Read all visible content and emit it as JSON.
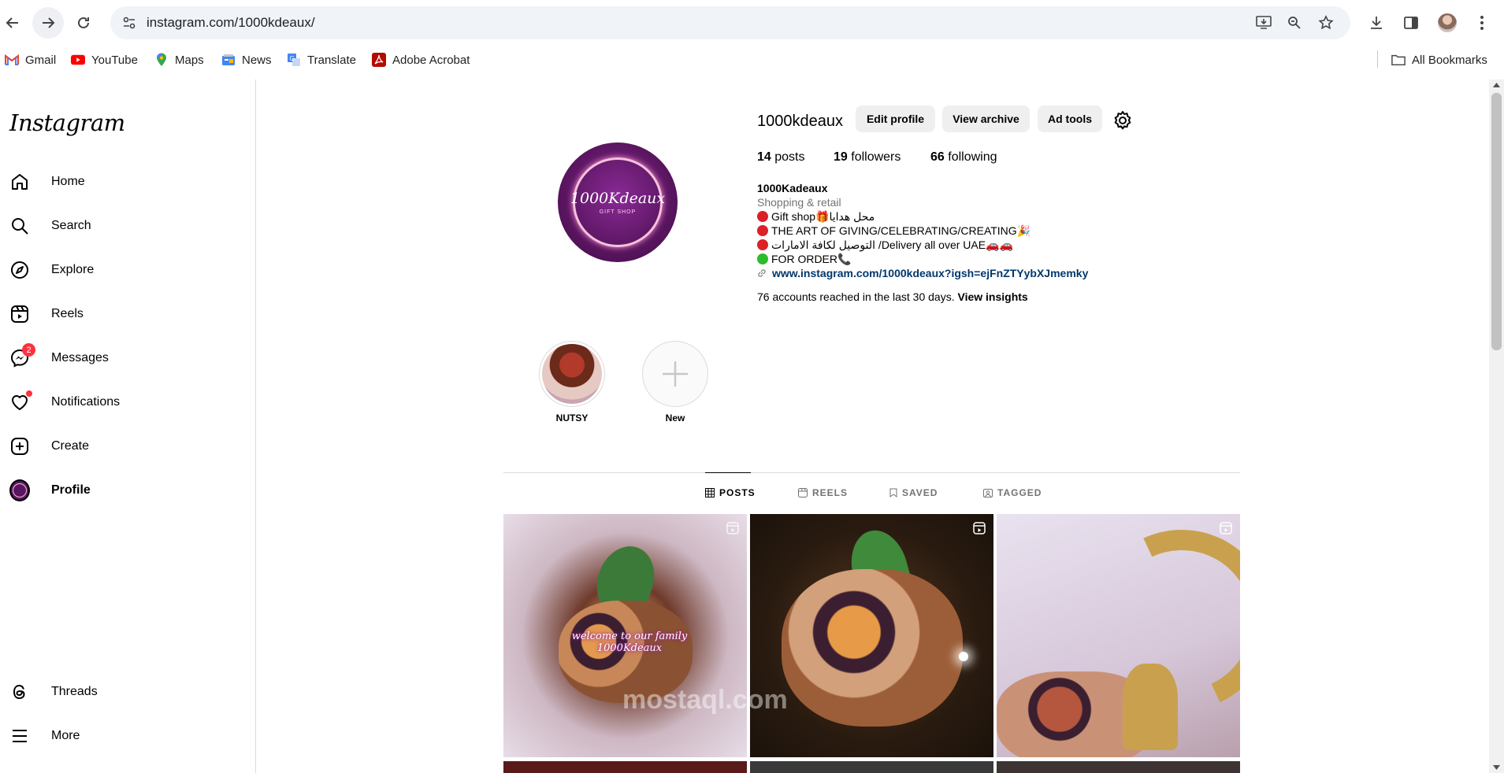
{
  "browser": {
    "url": "instagram.com/1000kdeaux/",
    "bookmarks": [
      {
        "label": "Gmail",
        "icon": "gmail-icon"
      },
      {
        "label": "YouTube",
        "icon": "youtube-icon"
      },
      {
        "label": "Maps",
        "icon": "maps-icon"
      },
      {
        "label": "News",
        "icon": "news-icon"
      },
      {
        "label": "Translate",
        "icon": "translate-icon"
      },
      {
        "label": "Adobe Acrobat",
        "icon": "acrobat-icon"
      }
    ],
    "all_bookmarks": "All Bookmarks"
  },
  "sidebar": {
    "logo": "Instagram",
    "items": [
      {
        "label": "Home",
        "icon": "home-icon"
      },
      {
        "label": "Search",
        "icon": "search-icon"
      },
      {
        "label": "Explore",
        "icon": "compass-icon"
      },
      {
        "label": "Reels",
        "icon": "reels-icon"
      },
      {
        "label": "Messages",
        "icon": "messenger-icon",
        "badge": "2"
      },
      {
        "label": "Notifications",
        "icon": "heart-icon"
      },
      {
        "label": "Create",
        "icon": "plus-square-icon"
      },
      {
        "label": "Profile",
        "icon": "profile-avatar-icon"
      }
    ],
    "bottom": [
      {
        "label": "Threads",
        "icon": "threads-icon"
      },
      {
        "label": "More",
        "icon": "menu-icon"
      }
    ]
  },
  "profile": {
    "username": "1000kdeaux",
    "avatar_text": "1000Kdeaux",
    "avatar_sub": "GIFT SHOP",
    "buttons": {
      "edit": "Edit profile",
      "archive": "View archive",
      "ad_tools": "Ad tools"
    },
    "stats": {
      "posts_count": "14",
      "posts_label": "posts",
      "followers_count": "19",
      "followers_label": "followers",
      "following_count": "66",
      "following_label": "following"
    },
    "bio": {
      "name": "1000Kadeaux",
      "category": "Shopping & retail",
      "line1": "Gift shop🎁محل هدايا",
      "line2": "THE ART OF GIVING/CELEBRATING/CREATING🎉",
      "line3": "التوصيل لكافة الامارات /Delivery all over UAE🚗🚗",
      "line4": "FOR ORDER📞",
      "link": "www.instagram.com/1000kdeaux?igsh=ejFnZTYybXJmemky"
    },
    "insights": {
      "text": "76 accounts reached in the last 30 days.",
      "action": "View insights"
    },
    "highlights": [
      {
        "label": "NUTSY"
      },
      {
        "label": "New"
      }
    ],
    "tabs": [
      "POSTS",
      "REELS",
      "SAVED",
      "TAGGED"
    ],
    "post_caption": "welcome to our family 1000Kdeaux",
    "watermark": "mostaql.com"
  },
  "colors": {
    "accent_link": "#00376b",
    "badge_red": "#ff3040",
    "avatar_purple": "#5a1560"
  }
}
